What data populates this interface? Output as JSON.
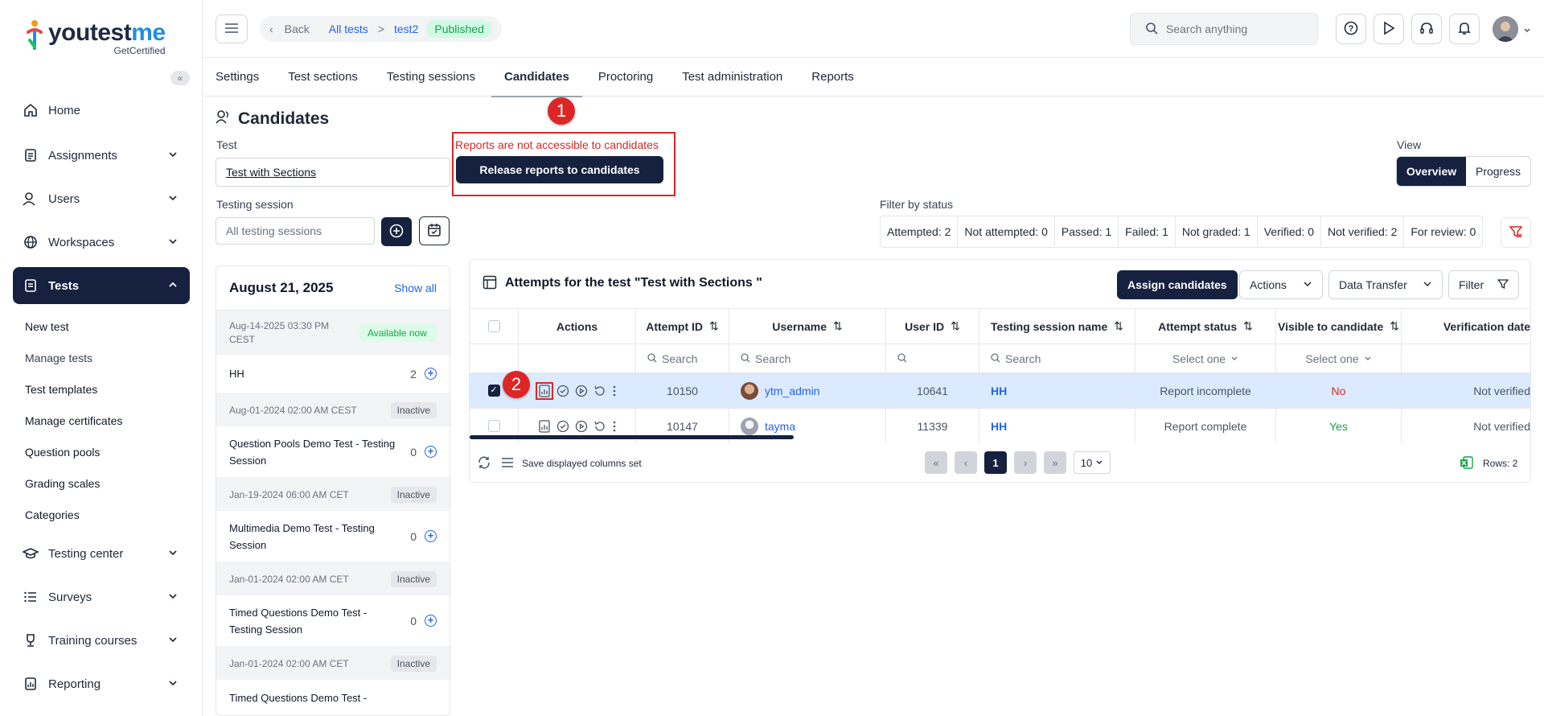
{
  "brand": {
    "name_a": "youtest",
    "name_b": "me",
    "sub": "GetCertified"
  },
  "sidebar": {
    "collapse": "«",
    "items": [
      {
        "label": "Home"
      },
      {
        "label": "Assignments"
      },
      {
        "label": "Users"
      },
      {
        "label": "Workspaces"
      },
      {
        "label": "Tests"
      },
      {
        "label": "Testing center"
      },
      {
        "label": "Surveys"
      },
      {
        "label": "Training courses"
      },
      {
        "label": "Reporting"
      }
    ],
    "tests_sub": [
      "New test",
      "Manage tests",
      "Test templates",
      "Manage certificates",
      "Question pools",
      "Grading scales",
      "Categories"
    ]
  },
  "topbar": {
    "back": "Back",
    "crumb1": "All tests",
    "sep": ">",
    "crumb2": "test2",
    "status": "Published",
    "search_placeholder": "Search anything"
  },
  "tabs": [
    "Settings",
    "Test sections",
    "Testing sessions",
    "Candidates",
    "Proctoring",
    "Test administration",
    "Reports"
  ],
  "page": {
    "title": "Candidates",
    "test_label": "Test",
    "test_value": "Test with Sections",
    "warning": "Reports are not accessible to candidates",
    "release_button": "Release reports to candidates",
    "view_label": "View",
    "view_overview": "Overview",
    "view_progress": "Progress",
    "session_label": "Testing session",
    "session_placeholder": "All testing sessions",
    "filter_label": "Filter by status",
    "filters": [
      "Attempted: 2",
      "Not attempted: 0",
      "Passed: 1",
      "Failed: 1",
      "Not graded: 1",
      "Verified: 0",
      "Not verified: 2",
      "For review: 0"
    ],
    "step1": "1",
    "step2": "2"
  },
  "sessions": {
    "date": "August 21, 2025",
    "show_all": "Show all",
    "groups": [
      {
        "date": "Aug-14-2025 03:30 PM CEST",
        "tag": "Available now",
        "name": "HH",
        "count": "2"
      },
      {
        "date": "Aug-01-2024 02:00 AM CEST",
        "tag": "Inactive",
        "name": "Question Pools Demo Test - Testing Session",
        "count": "0"
      },
      {
        "date": "Jan-19-2024 06:00 AM CET",
        "tag": "Inactive",
        "name": "Multimedia Demo Test - Testing Session",
        "count": "0"
      },
      {
        "date": "Jan-01-2024 02:00 AM CET",
        "tag": "Inactive",
        "name": "Timed Questions Demo Test - Testing Session",
        "count": "0"
      },
      {
        "date": "Jan-01-2024 02:00 AM CET",
        "tag": "Inactive",
        "name": "Timed Questions Demo Test -",
        "count": ""
      }
    ]
  },
  "table": {
    "title": "Attempts for the test \"Test with Sections \"",
    "assign": "Assign candidates",
    "actions": "Actions",
    "data_transfer": "Data Transfer",
    "filter": "Filter",
    "columns": [
      "Actions",
      "Attempt ID",
      "Username",
      "User ID",
      "Testing session name",
      "Attempt status",
      "Visible to candidate",
      "Verification date"
    ],
    "search": "Search",
    "select_one": "Select one",
    "rows": [
      {
        "attempt_id": "10150",
        "username": "ytm_admin",
        "user_id": "10641",
        "session": "HH",
        "status": "Report incomplete",
        "visible": "No",
        "verification": "Not verified"
      },
      {
        "attempt_id": "10147",
        "username": "tayma",
        "user_id": "11339",
        "session": "HH",
        "status": "Report complete",
        "visible": "Yes",
        "verification": "Not verified"
      }
    ],
    "save_columns": "Save displayed columns set",
    "page": "1",
    "per_page": "10",
    "rows_count": "Rows: 2"
  }
}
